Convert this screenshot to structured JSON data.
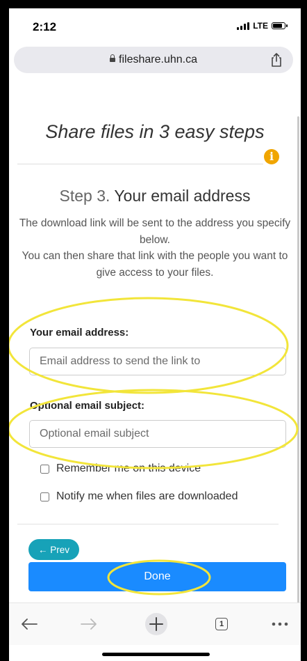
{
  "status_bar": {
    "time": "2:12",
    "network": "LTE"
  },
  "browser": {
    "url": "fileshare.uhn.ca",
    "tab_count": "1"
  },
  "page": {
    "title": "Share files in 3 easy steps",
    "info_icon_glyph": "i",
    "step_number": "Step 3.",
    "step_title": "Your email address",
    "description_line1": "The download link will be sent to the address you specify below.",
    "description_line2": "You can then share that link with the people you want to give access to your files."
  },
  "form": {
    "email_label": "Your email address:",
    "email_placeholder": "Email address to send the link to",
    "email_value": "",
    "subject_label": "Optional email subject:",
    "subject_placeholder": "Optional email subject",
    "subject_value": "",
    "remember_label": "Remember me on this device",
    "notify_label": "Notify me when files are downloaded",
    "remember_checked": false,
    "notify_checked": false
  },
  "buttons": {
    "prev_label": "← Prev",
    "done_label": "Done"
  },
  "colors": {
    "annotation": "#f2e53a",
    "prev_button": "#17a2b8",
    "done_button": "#1a8bff",
    "info_icon": "#f0a500"
  },
  "icons": {
    "lock": "lock-icon",
    "share": "share-icon",
    "back": "back-arrow-icon",
    "forward": "forward-arrow-icon",
    "new_tab": "plus-icon",
    "tabs": "tabs-icon",
    "menu": "more-icon"
  }
}
